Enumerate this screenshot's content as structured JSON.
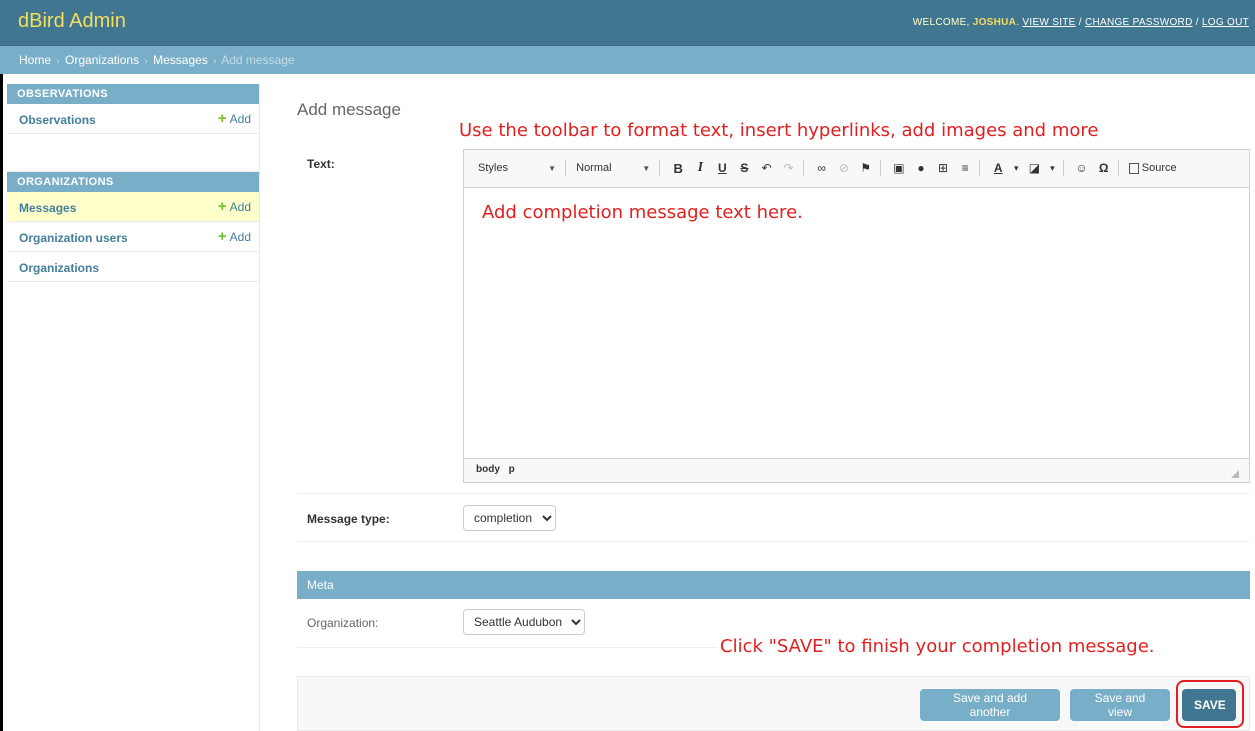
{
  "header": {
    "brand": "dBird Admin",
    "welcome_prefix": "WELCOME,",
    "username": "JOSHUA",
    "view_site": "VIEW SITE",
    "change_password": "CHANGE PASSWORD",
    "log_out": "LOG OUT",
    "separator": "/"
  },
  "breadcrumbs": {
    "home": "Home",
    "organizations": "Organizations",
    "messages": "Messages",
    "current": "Add message",
    "sep": "›"
  },
  "sidebar": {
    "observations_caption": "OBSERVATIONS",
    "observations": "Observations",
    "organizations_caption": "ORGANIZATIONS",
    "messages": "Messages",
    "organization_users": "Organization users",
    "organizations": "Organizations",
    "add_label": "Add"
  },
  "page": {
    "title": "Add message"
  },
  "annotations": {
    "toolbar_hint": "Use the toolbar to format text, insert hyperlinks, add images and more",
    "save_hint": "Click \"SAVE\" to finish your completion message."
  },
  "form": {
    "text_label": "Text:",
    "editor": {
      "styles": "Styles",
      "format": "Normal",
      "source": "Source",
      "content": "Add completion message text here.",
      "path_body": "body",
      "path_p": "p"
    },
    "message_type_label": "Message type:",
    "message_type_value": "completion",
    "meta_caption": "Meta",
    "organization_label": "Organization:",
    "organization_value": "Seattle Audubon"
  },
  "submit": {
    "save_add_another": "Save and add another",
    "save_view": "Save and view",
    "save": "SAVE"
  },
  "colors": {
    "header": "#417690",
    "brand": "#f5dd5d",
    "breadcrumbs": "#79aec8",
    "annotation": "#e21f1f",
    "link": "#447e9b",
    "add_plus": "#70bf2b"
  }
}
